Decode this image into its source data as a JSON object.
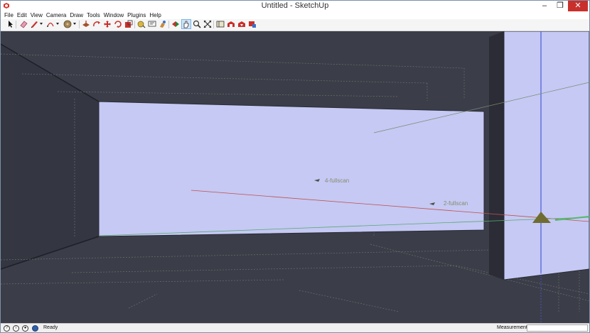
{
  "window": {
    "title": "Untitled - SketchUp",
    "controls": {
      "minimize": "–",
      "maximize": "❐",
      "close": "✕"
    }
  },
  "menu": [
    "File",
    "Edit",
    "View",
    "Camera",
    "Draw",
    "Tools",
    "Window",
    "Plugins",
    "Help"
  ],
  "toolbar": {
    "tools": [
      "select-tool",
      "eraser-tool",
      "pencil-line-tool",
      "arc-tool",
      "paint-bucket-tool",
      "push-pull-tool",
      "rotate-tool",
      "move-tool",
      "follow-me-tool",
      "scale-tool",
      "tape-measure-tool",
      "text-tool",
      "paint-tool",
      "orbit-tool",
      "pan-tool",
      "zoom-tool",
      "zoom-extents-tool",
      "components-tool",
      "warehouse-tool",
      "share-model-tool",
      "extension-tool"
    ],
    "active_tool": "pan-tool"
  },
  "viewport": {
    "background": "#3b3d49",
    "face_color": "#c5c9f4",
    "labels": {
      "scan4": "4-fullscan",
      "scan2": "2-fullscan"
    }
  },
  "status": {
    "text": "Ready",
    "measurements_label": "Measurements",
    "measurements_value": ""
  }
}
